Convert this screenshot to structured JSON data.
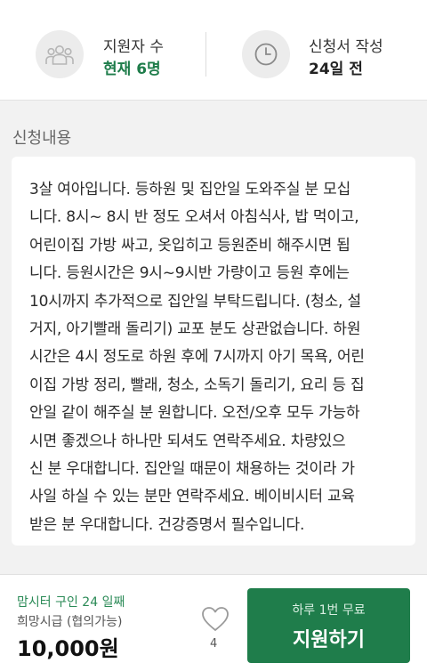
{
  "stats": {
    "applicants": {
      "label": "지원자 수",
      "value": "현재 6명",
      "icon": "people-icon",
      "color": "#1f7d4b"
    },
    "posted": {
      "label": "신청서 작성",
      "value": "24일 전",
      "icon": "clock-icon"
    }
  },
  "section": {
    "title": "신청내용",
    "lines": [
      "3살 여아입니다. 등하원 및 집안일 도와주실 분 모십",
      "니다. 8시~ 8시 반 정도 오셔서 아침식사, 밥 먹이고,",
      "어린이집 가방 싸고, 옷입히고 등원준비 해주시면 됩",
      "니다. 등원시간은 9시~9시반 가량이고 등원 후에는",
      "10시까지 추가적으로 집안일 부탁드립니다. (청소, 설",
      "거지, 아기빨래 돌리기) 교포 분도 상관없습니다. 하원",
      "시간은 4시 정도로 하원 후에 7시까지 아기 목욕, 어린",
      "이집 가방 정리, 빨래, 청소, 소독기 돌리기, 요리 등 집",
      "안일 같이 해주실 분 원합니다. 오전/오후 모두 가능하",
      "시면 좋겠으나 하나만 되셔도 연락주세요. 차량있으",
      "신 분 우대합니다. 집안일 때문이 채용하는 것이라 가",
      "사일 하실 수 있는 분만 연락주세요. 베이비시터 교육",
      "받은 분 우대합니다. 건강증명서 필수입니다."
    ]
  },
  "bottom": {
    "job_title": "맘시터 구인 24 일째",
    "wage_label": "희망시급 (협의가능)",
    "wage": "10,000원",
    "like_count": "4",
    "apply_sub": "하루 1번 무료",
    "apply_main": "지원하기",
    "accent": "#1f7d4b"
  }
}
